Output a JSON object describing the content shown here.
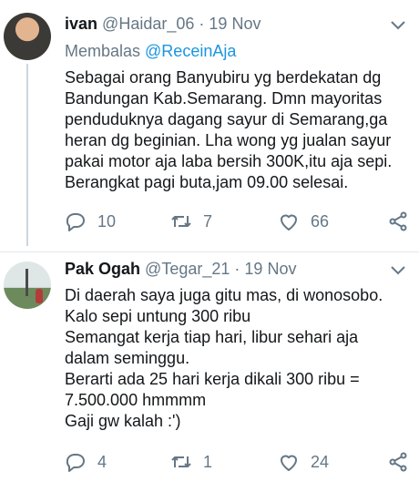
{
  "tweets": [
    {
      "display_name": "ivan",
      "handle": "@Haidar_06",
      "separator": "·",
      "date": "19 Nov",
      "reply_prefix": "Membalas ",
      "reply_to": "@ReceinAja",
      "text": "Sebagai orang Banyubiru yg berdekatan dg\nBandungan Kab.Semarang. Dmn mayoritas\npenduduknya dagang sayur di Semarang,ga\nheran dg beginian. Lha wong yg jualan sayur\npakai motor aja laba bersih 300K,itu aja sepi.\nBerangkat pagi buta,jam 09.00 selesai.",
      "replies": "10",
      "retweets": "7",
      "likes": "66"
    },
    {
      "display_name": "Pak Ogah",
      "handle": "@Tegar_21",
      "separator": "·",
      "date": "19 Nov",
      "text": "Di daerah saya juga gitu mas, di wonosobo.\nKalo sepi untung 300 ribu\nSemangat kerja tiap hari, libur sehari aja\ndalam seminggu.\nBerarti ada 25 hari kerja dikali 300 ribu =\n7.500.000 hmmmm\nGaji gw kalah :')",
      "replies": "4",
      "retweets": "1",
      "likes": "24"
    }
  ],
  "icons": {
    "reply": "speech-bubble",
    "retweet": "retweet-arrows",
    "like": "heart-outline",
    "share": "share-nodes",
    "menu": "chevron-down"
  },
  "colors": {
    "link": "#1b95e0",
    "muted": "#657786",
    "text": "#14171a",
    "divider": "#e1e8ed"
  }
}
